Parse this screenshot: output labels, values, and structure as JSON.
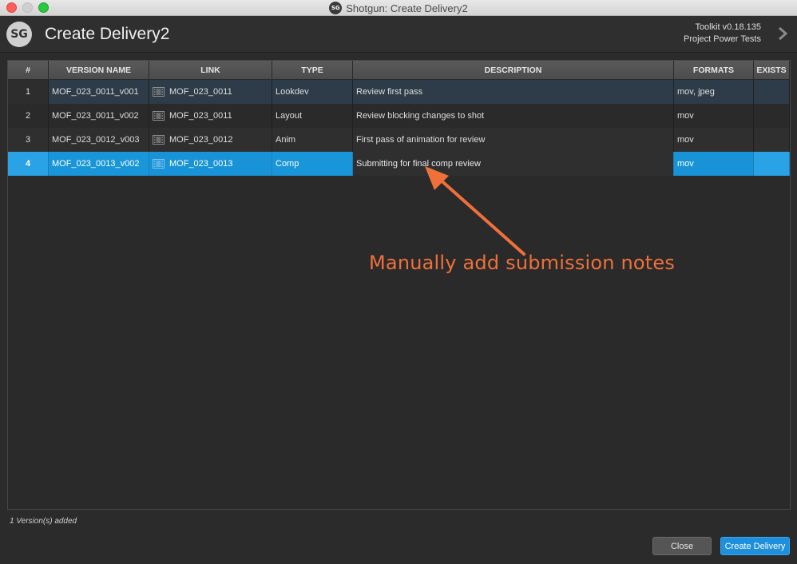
{
  "window": {
    "title": "Shotgun: Create Delivery2",
    "sg_mini": "SG"
  },
  "header": {
    "logo": "SG",
    "title": "Create Delivery2",
    "toolkit_version": "Toolkit v0.18.135",
    "project": "Project Power Tests"
  },
  "table": {
    "columns": [
      "#",
      "VERSION NAME",
      "LINK",
      "TYPE",
      "DESCRIPTION",
      "FORMATS",
      "EXISTS"
    ],
    "rows": [
      {
        "num": "1",
        "version": "MOF_023_0011_v001",
        "link": "MOF_023_0011",
        "type": "Lookdev",
        "description": "Review first pass",
        "formats": "mov, jpeg",
        "exists": ""
      },
      {
        "num": "2",
        "version": "MOF_023_0011_v002",
        "link": "MOF_023_0011",
        "type": "Layout",
        "description": "Review blocking changes to shot",
        "formats": "mov",
        "exists": ""
      },
      {
        "num": "3",
        "version": "MOF_023_0012_v003",
        "link": "MOF_023_0012",
        "type": "Anim",
        "description": "First pass of animation for review",
        "formats": "mov",
        "exists": ""
      },
      {
        "num": "4",
        "version": "MOF_023_0013_v002",
        "link": "MOF_023_0013",
        "type": "Comp",
        "description": "Submitting for final comp review",
        "formats": "mov",
        "exists": ""
      }
    ],
    "selected_row": 4
  },
  "annotation": {
    "text": "Manually add submission notes",
    "color": "#f0703a"
  },
  "footer": {
    "status": "1 Version(s) added",
    "close_label": "Close",
    "create_label": "Create Delivery"
  },
  "colors": {
    "accent": "#2aa3e6",
    "background": "#2b2b2b"
  }
}
